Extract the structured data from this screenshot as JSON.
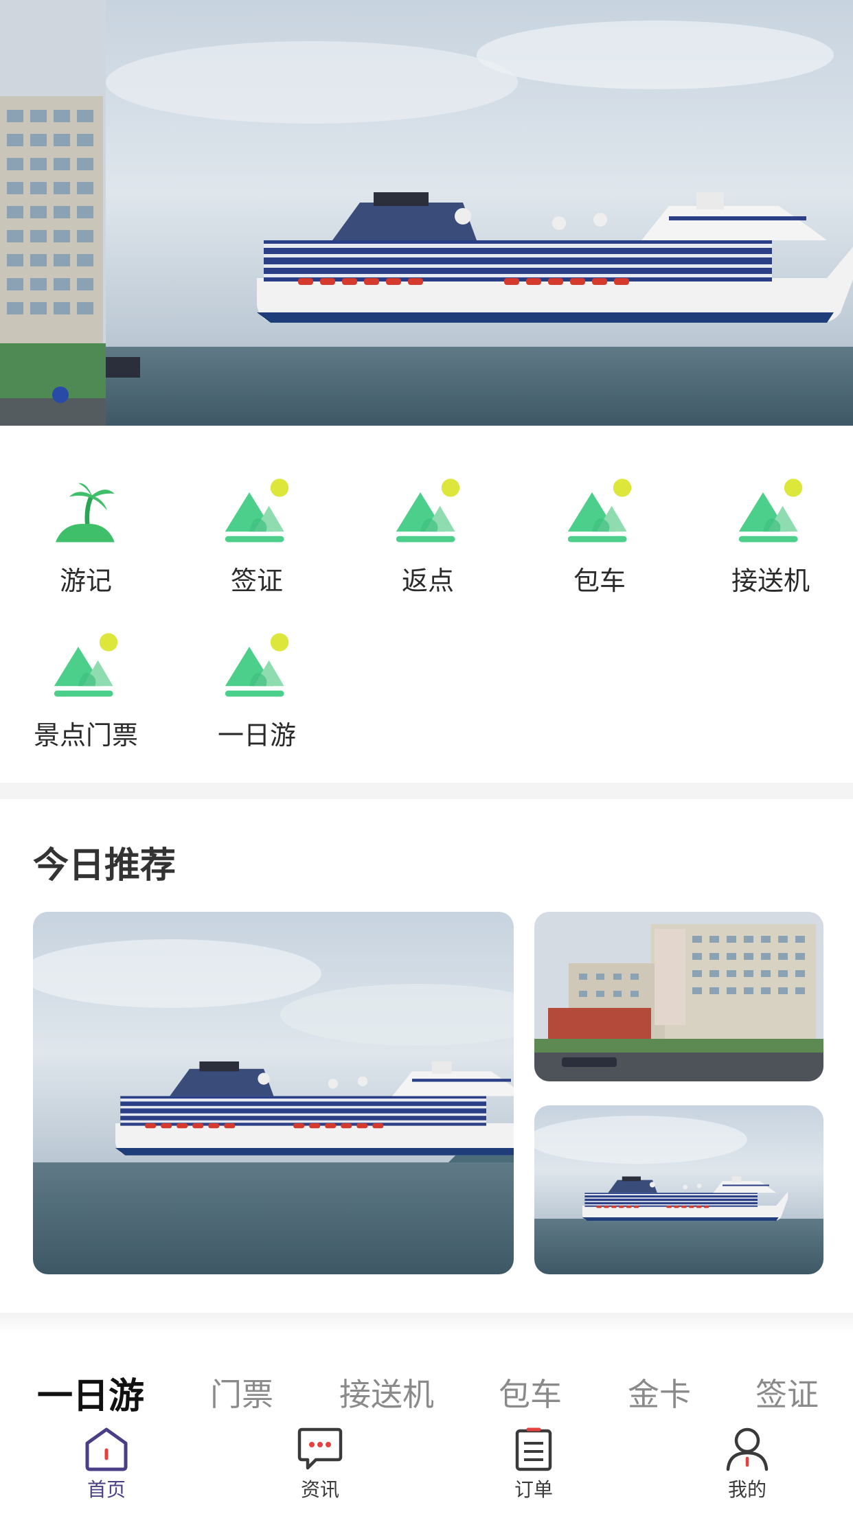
{
  "banner": {
    "image_description_icon": "cruise-ship-photo"
  },
  "categories": [
    {
      "label": "游记",
      "icon": "palm-island-icon"
    },
    {
      "label": "签证",
      "icon": "mountain-sun-icon"
    },
    {
      "label": "返点",
      "icon": "mountain-sun-icon"
    },
    {
      "label": "包车",
      "icon": "mountain-sun-icon"
    },
    {
      "label": "接送机",
      "icon": "mountain-sun-icon"
    },
    {
      "label": "景点门票",
      "icon": "mountain-sun-icon"
    },
    {
      "label": "一日游",
      "icon": "mountain-sun-icon"
    }
  ],
  "recommend": {
    "title": "今日推荐"
  },
  "subtabs": [
    {
      "label": "一日游",
      "active": true
    },
    {
      "label": "门票",
      "active": false
    },
    {
      "label": "接送机",
      "active": false
    },
    {
      "label": "包车",
      "active": false
    },
    {
      "label": "金卡",
      "active": false
    },
    {
      "label": "签证",
      "active": false
    }
  ],
  "bottom_nav": [
    {
      "label": "首页",
      "icon": "home-icon",
      "active": true
    },
    {
      "label": "资讯",
      "icon": "chat-bubble-icon",
      "active": false
    },
    {
      "label": "订单",
      "icon": "clipboard-icon",
      "active": false
    },
    {
      "label": "我的",
      "icon": "user-icon",
      "active": false
    }
  ],
  "colors": {
    "icon_green": "#4ccf8a",
    "icon_green_light": "#8fdcb0",
    "icon_sun": "#dde63a",
    "nav_active": "#4a3f86",
    "nav_accent_red": "#e5413f"
  }
}
